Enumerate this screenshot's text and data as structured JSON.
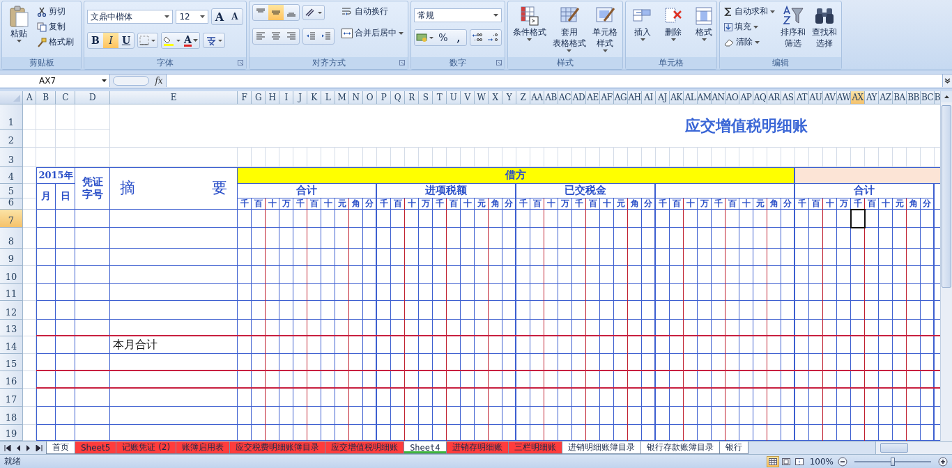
{
  "ribbon": {
    "clipboard": {
      "label": "剪贴板",
      "paste": "粘贴",
      "cut": "剪切",
      "copy": "复制",
      "format_painter": "格式刷"
    },
    "font": {
      "label": "字体",
      "family": "文鼎中楷体",
      "size": "12",
      "grow": "A",
      "shrink": "A",
      "bold": {
        "text": "B",
        "on": false
      },
      "italic": {
        "text": "I",
        "on": true
      },
      "underline": {
        "text": "U",
        "on": false
      },
      "font_color": "A"
    },
    "alignment": {
      "label": "对齐方式",
      "vertical": [
        {
          "kind": "top",
          "selected": false
        },
        {
          "kind": "middle",
          "selected": true
        },
        {
          "kind": "bottom",
          "selected": false
        }
      ],
      "wrap_text": "自动换行",
      "merge_center": "合并后居中"
    },
    "number": {
      "label": "数字",
      "format": "常规",
      "percent": "%",
      "comma": ","
    },
    "styles": {
      "label": "样式",
      "buttons": [
        {
          "kind": "conditional",
          "lines": [
            "条件格式"
          ]
        },
        {
          "kind": "table",
          "lines": [
            "套用",
            "表格格式"
          ]
        },
        {
          "kind": "cell",
          "lines": [
            "单元格",
            "样式"
          ]
        }
      ]
    },
    "cells": {
      "label": "单元格",
      "buttons": [
        {
          "kind": "insert",
          "label": "插入"
        },
        {
          "kind": "delete",
          "label": "删除"
        },
        {
          "kind": "format",
          "label": "格式"
        }
      ]
    },
    "editing": {
      "label": "编辑",
      "autosum": "自动求和",
      "fill": "填充",
      "clear": "清除",
      "sort": [
        "排序和",
        "筛选"
      ],
      "find": [
        "查找和",
        "选择"
      ]
    }
  },
  "formula_bar": {
    "name_box": "AX7",
    "fx": "fx"
  },
  "sheet": {
    "columns": [
      {
        "label": "A",
        "selected": false
      },
      {
        "label": "B",
        "selected": false
      },
      {
        "label": "C",
        "selected": false
      },
      {
        "label": "D",
        "selected": false
      },
      {
        "label": "E",
        "selected": false
      },
      {
        "label": "F",
        "selected": false
      },
      {
        "label": "G",
        "selected": false
      },
      {
        "label": "H",
        "selected": false
      },
      {
        "label": "I",
        "selected": false
      },
      {
        "label": "J",
        "selected": false
      },
      {
        "label": "K",
        "selected": false
      },
      {
        "label": "L",
        "selected": false
      },
      {
        "label": "M",
        "selected": false
      },
      {
        "label": "N",
        "selected": false
      },
      {
        "label": "O",
        "selected": false
      },
      {
        "label": "P",
        "selected": false
      },
      {
        "label": "Q",
        "selected": false
      },
      {
        "label": "R",
        "selected": false
      },
      {
        "label": "S",
        "selected": false
      },
      {
        "label": "T",
        "selected": false
      },
      {
        "label": "U",
        "selected": false
      },
      {
        "label": "V",
        "selected": false
      },
      {
        "label": "W",
        "selected": false
      },
      {
        "label": "X",
        "selected": false
      },
      {
        "label": "Y",
        "selected": false
      },
      {
        "label": "Z",
        "selected": false
      },
      {
        "label": "AA",
        "selected": false
      },
      {
        "label": "AB",
        "selected": false
      },
      {
        "label": "AC",
        "selected": false
      },
      {
        "label": "AD",
        "selected": false
      },
      {
        "label": "AE",
        "selected": false
      },
      {
        "label": "AF",
        "selected": false
      },
      {
        "label": "AG",
        "selected": false
      },
      {
        "label": "AH",
        "selected": false
      },
      {
        "label": "AI",
        "selected": false
      },
      {
        "label": "AJ",
        "selected": false
      },
      {
        "label": "AK",
        "selected": false
      },
      {
        "label": "AL",
        "selected": false
      },
      {
        "label": "AM",
        "selected": false
      },
      {
        "label": "AN",
        "selected": false
      },
      {
        "label": "AO",
        "selected": false
      },
      {
        "label": "AP",
        "selected": false
      },
      {
        "label": "AQ",
        "selected": false
      },
      {
        "label": "AR",
        "selected": false
      },
      {
        "label": "AS",
        "selected": false
      },
      {
        "label": "AT",
        "selected": false
      },
      {
        "label": "AU",
        "selected": false
      },
      {
        "label": "AV",
        "selected": false
      },
      {
        "label": "AW",
        "selected": false
      },
      {
        "label": "AX",
        "selected": true
      },
      {
        "label": "AY",
        "selected": false
      },
      {
        "label": "AZ",
        "selected": false
      },
      {
        "label": "BA",
        "selected": false
      },
      {
        "label": "BB",
        "selected": false
      },
      {
        "label": "BC",
        "selected": false
      },
      {
        "label": "B",
        "selected": false
      }
    ],
    "rows": [
      {
        "label": "1",
        "selected": false
      },
      {
        "label": "2",
        "selected": false
      },
      {
        "label": "3",
        "selected": false
      },
      {
        "label": "4",
        "selected": false
      },
      {
        "label": "5",
        "selected": false
      },
      {
        "label": "6",
        "selected": false
      },
      {
        "label": "7",
        "selected": true
      },
      {
        "label": "8",
        "selected": false
      },
      {
        "label": "9",
        "selected": false
      },
      {
        "label": "10",
        "selected": false
      },
      {
        "label": "11",
        "selected": false
      },
      {
        "label": "12",
        "selected": false
      },
      {
        "label": "13",
        "selected": false
      },
      {
        "label": "14",
        "selected": false
      },
      {
        "label": "15",
        "selected": false
      },
      {
        "label": "16",
        "selected": false
      },
      {
        "label": "17",
        "selected": false
      },
      {
        "label": "18",
        "selected": false
      },
      {
        "label": "19",
        "selected": false
      }
    ],
    "title": "应交增值税明细账",
    "ledger": {
      "year": "2015年",
      "month": "月",
      "day": "日",
      "voucher": "凭证字号",
      "summary": "摘要",
      "debit": "借方",
      "groups": [
        {
          "title": "合计",
          "units": [
            "千",
            "百",
            "十",
            "万",
            "千",
            "百",
            "十",
            "元",
            "角",
            "分"
          ]
        },
        {
          "title": "进项税额",
          "units": [
            "千",
            "百",
            "十",
            "万",
            "千",
            "百",
            "十",
            "元",
            "角",
            "分"
          ]
        },
        {
          "title": "已交税金",
          "units": [
            "千",
            "百",
            "十",
            "万",
            "千",
            "百",
            "十",
            "元",
            "角",
            "分"
          ]
        },
        {
          "units": [
            "千",
            "百",
            "十",
            "万",
            "千",
            "百",
            "十",
            "元",
            "角",
            "分"
          ]
        },
        {
          "title": "合计",
          "units": [
            "千",
            "百",
            "十",
            "万",
            "千",
            "百",
            "十",
            "元",
            "角",
            "分"
          ]
        }
      ],
      "total_row": {
        "summary": "本月合计"
      }
    }
  },
  "sheet_tabs": [
    {
      "label": "首页",
      "color": "#ffffff",
      "selected": false
    },
    {
      "label": "Sheet5",
      "color": "#ff3c3c",
      "selected": false
    },
    {
      "label": "记账凭证 (2)",
      "color": "#ff3c3c",
      "selected": false
    },
    {
      "label": "账簿启用表",
      "color": "#ff3c3c",
      "selected": false
    },
    {
      "label": "应交税费明细账簿目录",
      "color": "#ff3c3c",
      "selected": false
    },
    {
      "label": "应交增值税明细账",
      "color": "#ff3c3c",
      "selected": false
    },
    {
      "label": "Sheet4",
      "color": "#3cb43c",
      "selected": true
    },
    {
      "label": "进销存明细账",
      "color": "#ff3c3c",
      "selected": false
    },
    {
      "label": "三栏明细账",
      "color": "#ff3c3c",
      "selected": false
    },
    {
      "label": "进销明细账簿目录",
      "color": "#ffffff",
      "selected": false
    },
    {
      "label": "银行存款账簿目录",
      "color": "#ffffff",
      "selected": false
    },
    {
      "label": "银行",
      "color": "#ffffff",
      "selected": false
    }
  ],
  "status_bar": {
    "status": "就绪",
    "views": [
      {
        "kind": "normal",
        "selected": true
      },
      {
        "kind": "layout",
        "selected": false
      },
      {
        "kind": "break",
        "selected": false
      }
    ],
    "zoom": "100%",
    "zoom_slider": {
      "level": 0.5
    }
  }
}
